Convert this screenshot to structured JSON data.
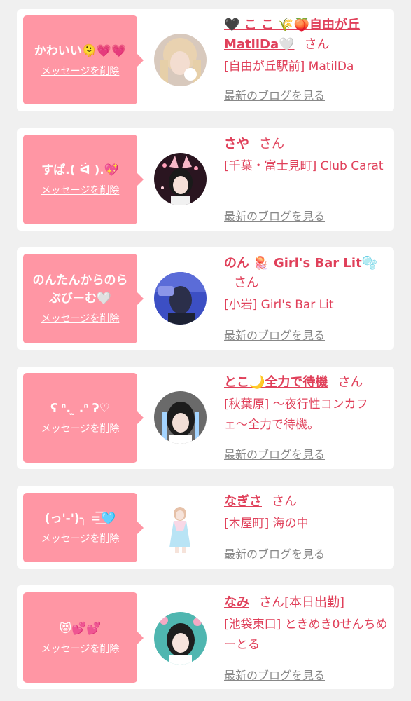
{
  "delete_label": "メッセージを削除",
  "honorific": "さん",
  "blog_label": "最新のブログを見る",
  "colors": {
    "page_bg": "#f0f0f0",
    "card_bg": "#ffffff",
    "bubble_pink": "#ff96a4",
    "accent_text": "#e0405a",
    "link_gray": "#888888"
  },
  "items": [
    {
      "message": "かわいい🫠💗💗",
      "name": "🖤 こ こ 🌾🍑自由が丘MatilDa🤍",
      "shop": "[自由が丘駅前] MatilDa",
      "avatar_icon": "girl-photo-icon"
    },
    {
      "message": "すぱ.( ᐛ ).💖",
      "name": "さや",
      "shop": "[千葉・富士見町] Club Carat",
      "avatar_icon": "girl-photo-icon"
    },
    {
      "message": "のんたんからのらぶびーむ🤍",
      "name": "のん 🪼 Girl's Bar Lit🫧",
      "shop": "[小岩] Girl's Bar Lit",
      "avatar_icon": "girl-photo-icon"
    },
    {
      "message": "ʕ ᐢ. ̫ .ᐢ ʔ♡",
      "name": "とこ🌙全力で待機",
      "shop": "[秋葉原] 〜夜行性コンカフェ〜全力で待機。",
      "avatar_icon": "girl-photo-icon"
    },
    {
      "message": "(っ'-')╮ =͟͟͞͞🩵",
      "name": "なぎさ",
      "shop": "[木屋町] 海の中",
      "avatar_icon": "girl-photo-icon"
    },
    {
      "message": "😻💕💕",
      "name": "なみ",
      "name_suffix": "[本日出勤]",
      "shop": "[池袋東口] ときめき0せんちめーとる",
      "avatar_icon": "girl-photo-icon"
    }
  ]
}
